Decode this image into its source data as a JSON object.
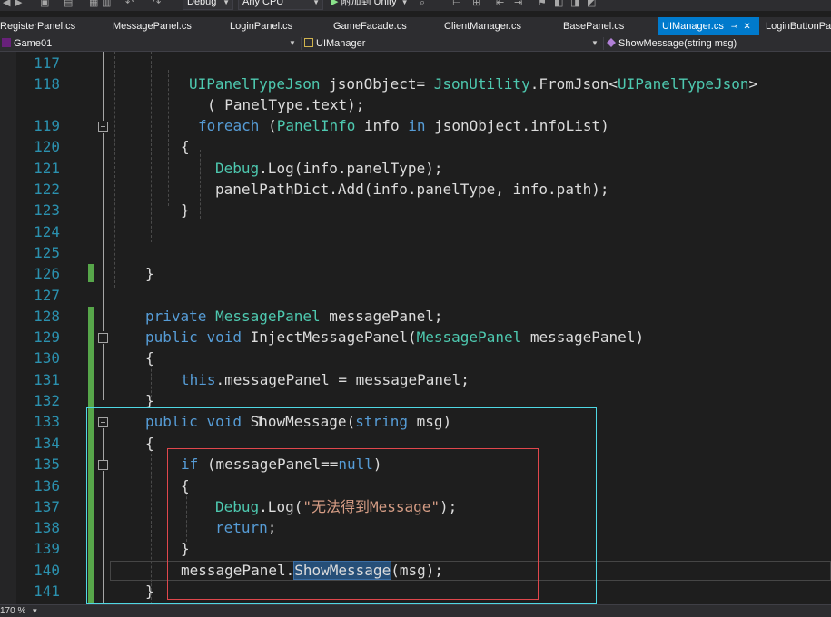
{
  "toolbar": {
    "configuration": "Debug",
    "platform": "Any CPU",
    "attach_label": "附加到 Unity"
  },
  "tabs": [
    {
      "label": "RegisterPanel.cs",
      "active": false
    },
    {
      "label": "MessagePanel.cs",
      "active": false
    },
    {
      "label": "LoginPanel.cs",
      "active": false
    },
    {
      "label": "GameFacade.cs",
      "active": false
    },
    {
      "label": "ClientManager.cs",
      "active": false
    },
    {
      "label": "BasePanel.cs",
      "active": false
    },
    {
      "label": "UIManager.cs",
      "active": true
    },
    {
      "label": "LoginButtonPa",
      "active": false
    }
  ],
  "nav": {
    "project": "Game01",
    "class": "UIManager",
    "member": "ShowMessage(string msg)"
  },
  "editor": {
    "line_numbers": [
      "117",
      "118",
      "",
      "119",
      "120",
      "121",
      "122",
      "123",
      "124",
      "125",
      "126",
      "127",
      "128",
      "129",
      "130",
      "131",
      "132",
      "133",
      "134",
      "135",
      "136",
      "137",
      "138",
      "139",
      "140",
      "141"
    ],
    "code": {
      "l118a": [
        "UIPanelTypeJson",
        " jsonObject= ",
        "JsonUtility",
        ".FromJson<",
        "UIPanelTypeJson",
        ">"
      ],
      "l118b": "(_PanelType.text);",
      "l119": [
        "foreach",
        " (",
        "PanelInfo",
        " info ",
        "in",
        " jsonObject.infoList)"
      ],
      "l120": "{",
      "l121": [
        "Debug",
        ".Log(info.panelType);"
      ],
      "l122": "panelPathDict.Add(info.panelType, info.path);",
      "l123": "}",
      "l126": "}",
      "l128": [
        "private",
        " ",
        "MessagePanel",
        " messagePanel;"
      ],
      "l129": [
        "public",
        " ",
        "void",
        " InjectMessagePanel(",
        "MessagePanel",
        " messagePanel)"
      ],
      "l130": "{",
      "l131": [
        "this",
        ".messagePanel = messagePanel;"
      ],
      "l132": "}",
      "l133": [
        "public",
        " ",
        "void",
        " ShowMessage(",
        "string",
        " msg)"
      ],
      "l134": "{",
      "l135": [
        "if",
        " (messagePanel==",
        "null",
        ")"
      ],
      "l136": "{",
      "l137": [
        "Debug",
        ".Log(",
        "\"无法得到Message\"",
        ");"
      ],
      "l138": [
        "return",
        ";"
      ],
      "l139": "}",
      "l140": [
        "messagePanel.",
        "ShowMessage",
        "(msg);"
      ],
      "l141": "}"
    },
    "selected_text": "ShowMessage",
    "current_line": "140"
  },
  "status": {
    "zoom": "170 %"
  },
  "colors": {
    "keyword": "#569cd6",
    "type": "#4ec9b0",
    "string": "#d69d85",
    "line_number": "#2b91af",
    "accent": "#007acc",
    "change_bar": "#57a64a",
    "red_box": "#e0474c",
    "cyan_box": "#4fd8e4"
  }
}
